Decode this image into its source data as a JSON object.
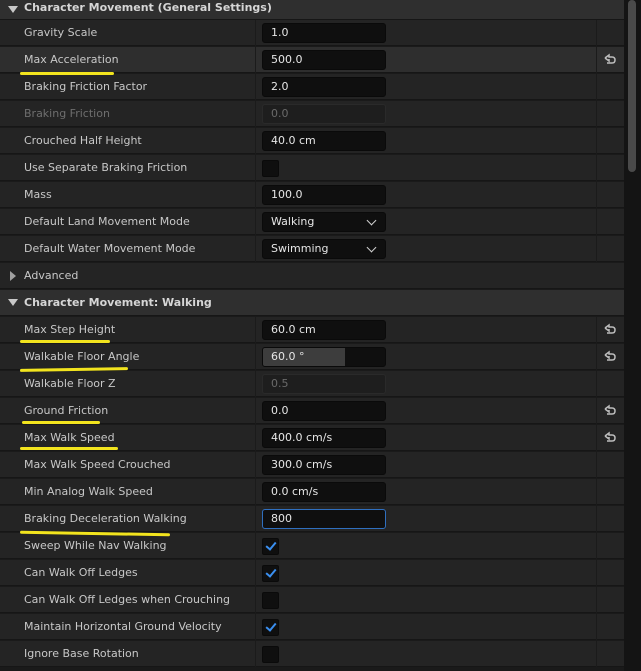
{
  "sections": {
    "general": "Character Movement (General Settings)",
    "advanced": "Advanced",
    "walking": "Character Movement: Walking"
  },
  "rows": {
    "gravity_scale": {
      "label": "Gravity Scale",
      "value": "1.0"
    },
    "max_acceleration": {
      "label": "Max Acceleration",
      "value": "500.0"
    },
    "braking_friction_factor": {
      "label": "Braking Friction Factor",
      "value": "2.0"
    },
    "braking_friction": {
      "label": "Braking Friction",
      "value": "0.0"
    },
    "crouched_half_height": {
      "label": "Crouched Half Height",
      "value": "40.0 cm"
    },
    "use_separate_braking_friction": {
      "label": "Use Separate Braking Friction",
      "checked": false
    },
    "mass": {
      "label": "Mass",
      "value": "100.0"
    },
    "default_land_movement_mode": {
      "label": "Default Land Movement Mode",
      "value": "Walking"
    },
    "default_water_movement_mode": {
      "label": "Default Water Movement Mode",
      "value": "Swimming"
    },
    "max_step_height": {
      "label": "Max Step Height",
      "value": "60.0 cm"
    },
    "walkable_floor_angle": {
      "label": "Walkable Floor Angle",
      "value": "60.0 °",
      "fill_fraction": 0.67
    },
    "walkable_floor_z": {
      "label": "Walkable Floor Z",
      "value": "0.5"
    },
    "ground_friction": {
      "label": "Ground Friction",
      "value": "0.0"
    },
    "max_walk_speed": {
      "label": "Max Walk Speed",
      "value": "400.0 cm/s"
    },
    "max_walk_speed_crouched": {
      "label": "Max Walk Speed Crouched",
      "value": "300.0 cm/s"
    },
    "min_analog_walk_speed": {
      "label": "Min Analog Walk Speed",
      "value": "0.0 cm/s"
    },
    "braking_deceleration_walking": {
      "label": "Braking Deceleration Walking",
      "value": "800"
    },
    "sweep_while_nav_walking": {
      "label": "Sweep While Nav Walking",
      "checked": true
    },
    "can_walk_off_ledges": {
      "label": "Can Walk Off Ledges",
      "checked": true
    },
    "can_walk_off_ledges_crouching": {
      "label": "Can Walk Off Ledges when Crouching",
      "checked": false
    },
    "maintain_horizontal_ground_velocity": {
      "label": "Maintain Horizontal Ground Velocity",
      "checked": true
    },
    "ignore_base_rotation": {
      "label": "Ignore Base Rotation",
      "checked": false
    }
  },
  "colors": {
    "highlight_underline": "#f2e41e",
    "checkmark": "#3a8ff0",
    "focus_border": "#2f6fbf"
  },
  "icons": {
    "reset": "reset-to-default-icon",
    "expand": "chevron-down-icon",
    "collapsed": "chevron-right-icon"
  }
}
